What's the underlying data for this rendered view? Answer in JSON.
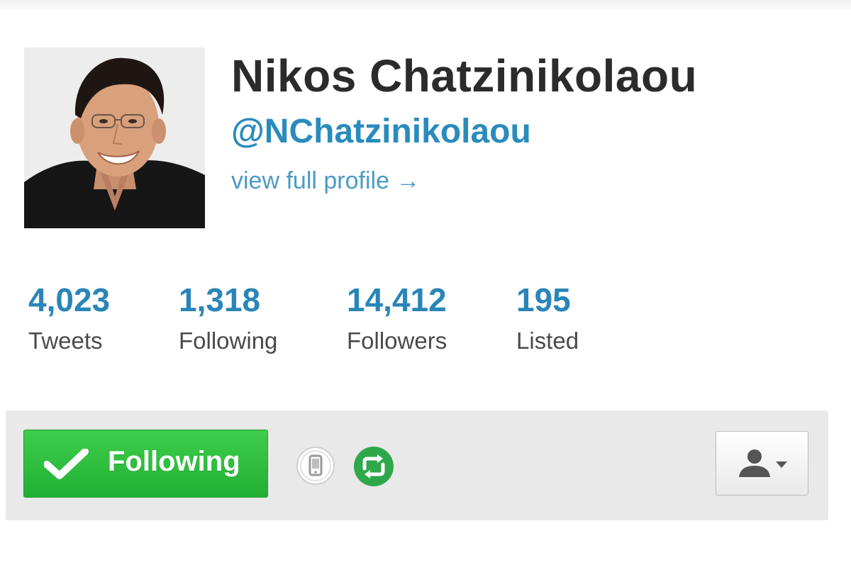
{
  "profile": {
    "name": "Nikos Chatzinikolaou",
    "handle": "@NChatzinikolaou",
    "view_profile_label": "view full profile →",
    "avatar_alt": "profile-photo"
  },
  "stats": [
    {
      "value": "4,023",
      "label": "Tweets"
    },
    {
      "value": "1,318",
      "label": "Following"
    },
    {
      "value": "14,412",
      "label": "Followers"
    },
    {
      "value": "195",
      "label": "Listed"
    }
  ],
  "actions": {
    "follow_label": "Following",
    "follow_icon": "check-icon",
    "device_icon": "mobile-device-icon",
    "retweet_icon": "retweets-icon",
    "user_menu_icon": "user-dropdown-icon"
  },
  "colors": {
    "link_blue": "#2a85b8",
    "follow_green": "#2bbf3d",
    "text_dark": "#2b2b2b"
  }
}
